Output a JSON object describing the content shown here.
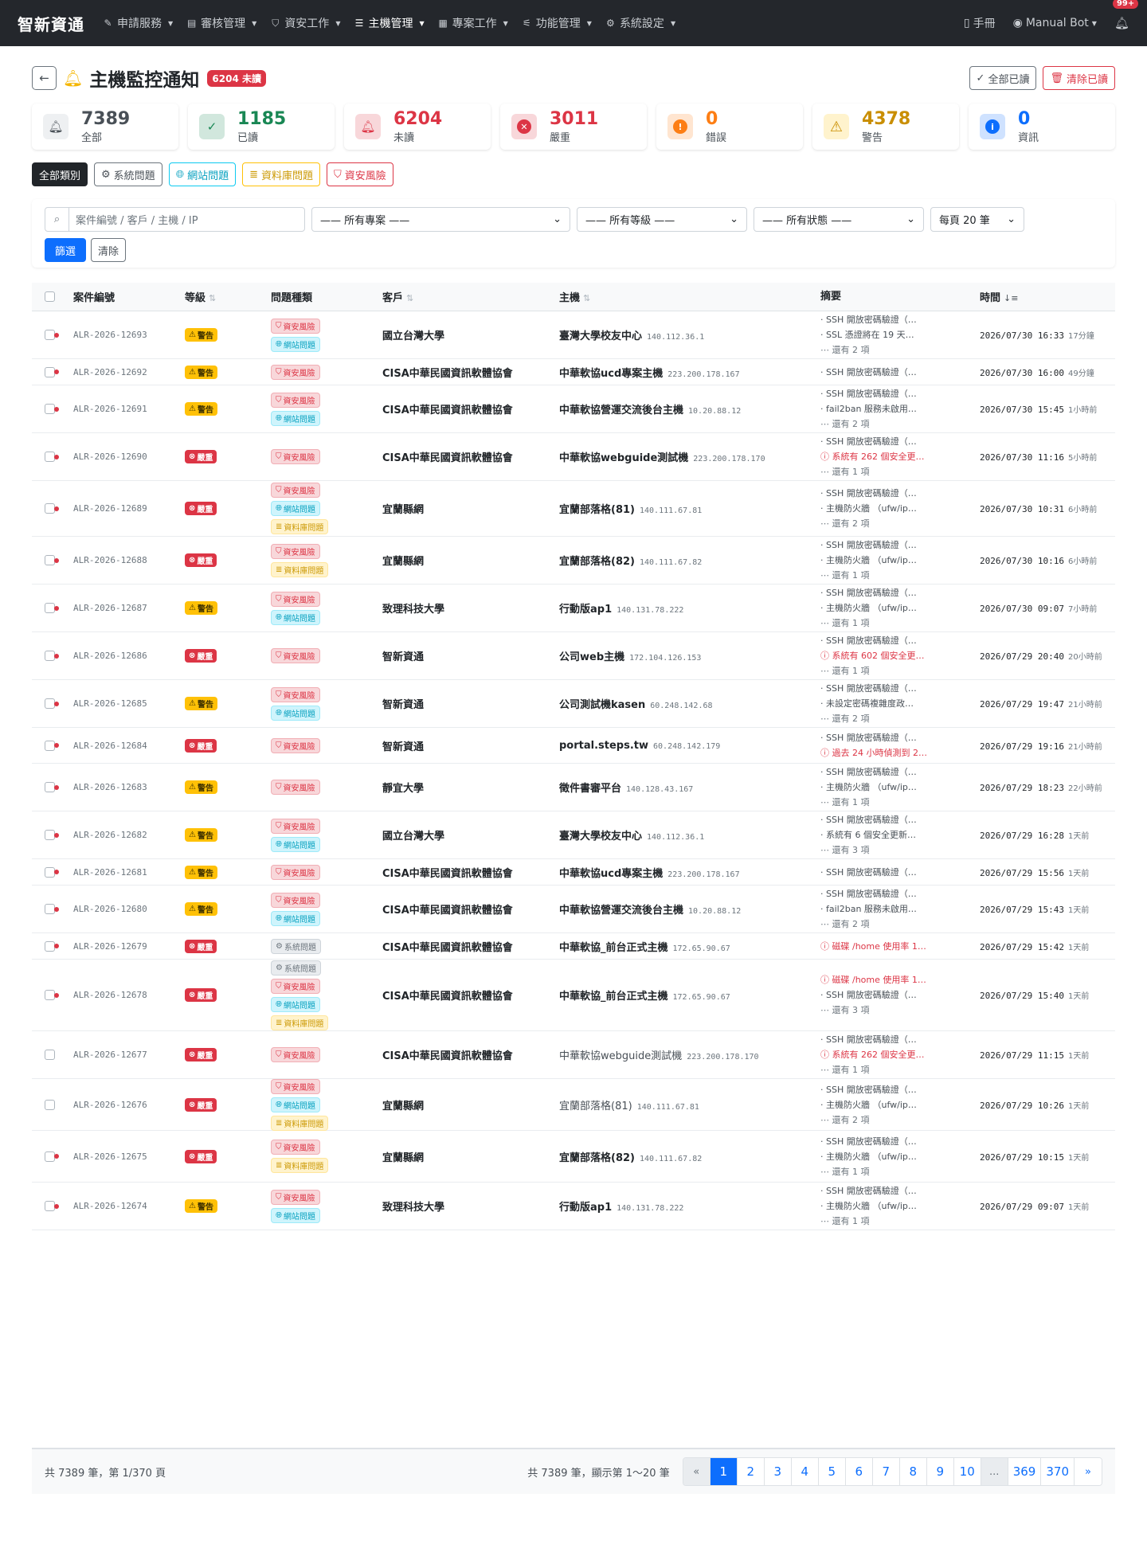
{
  "nav": {
    "brand": "智新資通",
    "items": [
      {
        "label": "申請服務",
        "icon": "edit-icon",
        "glyph": "✎"
      },
      {
        "label": "審核管理",
        "icon": "clipboard-icon",
        "glyph": "▤"
      },
      {
        "label": "資安工作",
        "icon": "shield-icon",
        "glyph": "⛉"
      },
      {
        "label": "主機管理",
        "icon": "server-icon",
        "glyph": "☰"
      },
      {
        "label": "專案工作",
        "icon": "kanban-icon",
        "glyph": "▦"
      },
      {
        "label": "功能管理",
        "icon": "sliders-icon",
        "glyph": "⚟"
      },
      {
        "label": "系統設定",
        "icon": "gear-icon",
        "glyph": "⚙"
      }
    ],
    "manual": "手冊",
    "user": "Manual Bot",
    "bell_badge": "99+"
  },
  "header": {
    "title": "主機監控通知",
    "badge": "6204 未讀",
    "mark_all_read": "全部已讀",
    "clear_read": "清除已讀"
  },
  "stats": [
    {
      "num": "7389",
      "label": "全部",
      "color": "#495057",
      "bg": "#eef0f2",
      "glyph": "🔔︎",
      "icon": "bell-icon"
    },
    {
      "num": "1185",
      "label": "已讀",
      "color": "#198754",
      "bg": "#d1e7dd",
      "glyph": "✓",
      "icon": "check-circle-icon"
    },
    {
      "num": "6204",
      "label": "未讀",
      "color": "#dc3545",
      "bg": "#f8d7da",
      "glyph": "🔔︎",
      "icon": "bell-fill-icon"
    },
    {
      "num": "3011",
      "label": "嚴重",
      "color": "#dc3545",
      "bg": "#f8d7da",
      "glyph": "✕",
      "icon": "x-circle-icon"
    },
    {
      "num": "0",
      "label": "錯誤",
      "color": "#fd7e14",
      "bg": "#ffe5d0",
      "glyph": "!",
      "icon": "exclamation-octagon-icon"
    },
    {
      "num": "4378",
      "label": "警告",
      "color": "#c98e00",
      "bg": "#fff3cd",
      "glyph": "⚠",
      "icon": "warning-triangle-icon"
    },
    {
      "num": "0",
      "label": "資訊",
      "color": "#0d6efd",
      "bg": "#cfe2ff",
      "glyph": "i",
      "icon": "info-circle-icon"
    }
  ],
  "categories": [
    {
      "label": "全部類別",
      "glyph": "",
      "border": "#212529",
      "color": "#fff",
      "bg": "#212529"
    },
    {
      "label": "系統問題",
      "glyph": "⚙",
      "border": "#6c757d",
      "color": "#495057",
      "bg": "#fff"
    },
    {
      "label": "網站問題",
      "glyph": "🌐︎",
      "border": "#0dcaf0",
      "color": "#0aa2c0",
      "bg": "#fff"
    },
    {
      "label": "資料庫問題",
      "glyph": "≣",
      "border": "#ffc107",
      "color": "#cc9a06",
      "bg": "#fff"
    },
    {
      "label": "資安風險",
      "glyph": "⛉",
      "border": "#dc3545",
      "color": "#dc3545",
      "bg": "#fff"
    }
  ],
  "filter": {
    "search_placeholder": "案件編號 / 客戶 / 主機 / IP",
    "project": "—— 所有專案 ——",
    "level": "—— 所有等級 ——",
    "status": "—— 所有狀態 ——",
    "per_page": "每頁 20 筆",
    "submit": "篩選",
    "clear": "清除"
  },
  "columns": {
    "id": "案件編號",
    "level": "等級",
    "type": "問題種類",
    "customer": "客戶",
    "host": "主機",
    "summary": "摘要",
    "time": "時間"
  },
  "level_labels": {
    "warn": "警告",
    "crit": "嚴重"
  },
  "type_labels": {
    "sec": "資安風險",
    "web": "網站問題",
    "db": "資料庫問題",
    "sys": "系統問題"
  },
  "rows": [
    {
      "id": "ALR-2026-12693",
      "level": "warn",
      "types": [
        "sec",
        "web"
      ],
      "customer": "國立台灣大學",
      "host": "臺灣大學校友中心",
      "ip": "140.112.36.1",
      "unread": true,
      "summary": [
        {
          "t": "· SSH 開放密碼驗證（…"
        },
        {
          "t": "· SSL 憑證將在 19 天…"
        }
      ],
      "more": "⋯ 還有 2 項",
      "time": "2026/07/30 16:33",
      "ago": "17分鐘"
    },
    {
      "id": "ALR-2026-12692",
      "level": "warn",
      "types": [
        "sec"
      ],
      "customer": "CISA中華民國資訊軟體協會",
      "host": "中華軟協ucd專案主機",
      "ip": "223.200.178.167",
      "unread": true,
      "summary": [
        {
          "t": "· SSH 開放密碼驗證（…"
        }
      ],
      "more": "",
      "time": "2026/07/30 16:00",
      "ago": "49分鐘"
    },
    {
      "id": "ALR-2026-12691",
      "level": "warn",
      "types": [
        "sec",
        "web"
      ],
      "customer": "CISA中華民國資訊軟體協會",
      "host": "中華軟協營運交流後台主機",
      "ip": "10.20.88.12",
      "unread": true,
      "summary": [
        {
          "t": "· SSH 開放密碼驗證（…"
        },
        {
          "t": "· fail2ban 服務未啟用…"
        }
      ],
      "more": "⋯ 還有 2 項",
      "time": "2026/07/30 15:45",
      "ago": "1小時前"
    },
    {
      "id": "ALR-2026-12690",
      "level": "crit",
      "types": [
        "sec"
      ],
      "customer": "CISA中華民國資訊軟體協會",
      "host": "中華軟協webguide測試機",
      "ip": "223.200.178.170",
      "unread": true,
      "summary": [
        {
          "t": "· SSH 開放密碼驗證（…"
        },
        {
          "t": "ⓘ 系統有 262 個安全更…",
          "err": true
        }
      ],
      "more": "⋯ 還有 1 項",
      "time": "2026/07/30 11:16",
      "ago": "5小時前"
    },
    {
      "id": "ALR-2026-12689",
      "level": "crit",
      "types": [
        "sec",
        "web",
        "db"
      ],
      "customer": "宜蘭縣網",
      "host": "宜蘭部落格(81)",
      "ip": "140.111.67.81",
      "unread": true,
      "summary": [
        {
          "t": "· SSH 開放密碼驗證（…"
        },
        {
          "t": "· 主機防火牆 （ufw/ip…"
        }
      ],
      "more": "⋯ 還有 2 項",
      "time": "2026/07/30 10:31",
      "ago": "6小時前"
    },
    {
      "id": "ALR-2026-12688",
      "level": "crit",
      "types": [
        "sec",
        "db"
      ],
      "customer": "宜蘭縣網",
      "host": "宜蘭部落格(82)",
      "ip": "140.111.67.82",
      "unread": true,
      "summary": [
        {
          "t": "· SSH 開放密碼驗證（…"
        },
        {
          "t": "· 主機防火牆 （ufw/ip…"
        }
      ],
      "more": "⋯ 還有 1 項",
      "time": "2026/07/30 10:16",
      "ago": "6小時前"
    },
    {
      "id": "ALR-2026-12687",
      "level": "warn",
      "types": [
        "sec",
        "web"
      ],
      "customer": "致理科技大學",
      "host": "行動版ap1",
      "ip": "140.131.78.222",
      "unread": true,
      "summary": [
        {
          "t": "· SSH 開放密碼驗證（…"
        },
        {
          "t": "· 主機防火牆 （ufw/ip…"
        }
      ],
      "more": "⋯ 還有 1 項",
      "time": "2026/07/30 09:07",
      "ago": "7小時前"
    },
    {
      "id": "ALR-2026-12686",
      "level": "crit",
      "types": [
        "sec"
      ],
      "customer": "智新資通",
      "host": "公司web主機",
      "ip": "172.104.126.153",
      "unread": true,
      "summary": [
        {
          "t": "· SSH 開放密碼驗證（…"
        },
        {
          "t": "ⓘ 系統有 602 個安全更…",
          "err": true
        }
      ],
      "more": "⋯ 還有 1 項",
      "time": "2026/07/29 20:40",
      "ago": "20小時前"
    },
    {
      "id": "ALR-2026-12685",
      "level": "warn",
      "types": [
        "sec",
        "web"
      ],
      "customer": "智新資通",
      "host": "公司測試機kasen",
      "ip": "60.248.142.68",
      "unread": true,
      "summary": [
        {
          "t": "· SSH 開放密碼驗證（…"
        },
        {
          "t": "· 未設定密碼複雜度政…"
        }
      ],
      "more": "⋯ 還有 2 項",
      "time": "2026/07/29 19:47",
      "ago": "21小時前"
    },
    {
      "id": "ALR-2026-12684",
      "level": "crit",
      "types": [
        "sec"
      ],
      "customer": "智新資通",
      "host": "portal.steps.tw",
      "ip": "60.248.142.179",
      "unread": true,
      "summary": [
        {
          "t": "· SSH 開放密碼驗證（…"
        },
        {
          "t": "ⓘ 過去 24 小時偵測到 2…",
          "err": true
        }
      ],
      "more": "",
      "time": "2026/07/29 19:16",
      "ago": "21小時前"
    },
    {
      "id": "ALR-2026-12683",
      "level": "warn",
      "types": [
        "sec"
      ],
      "customer": "靜宜大學",
      "host": "徵件書審平台",
      "ip": "140.128.43.167",
      "unread": true,
      "summary": [
        {
          "t": "· SSH 開放密碼驗證（…"
        },
        {
          "t": "· 主機防火牆 （ufw/ip…"
        }
      ],
      "more": "⋯ 還有 1 項",
      "time": "2026/07/29 18:23",
      "ago": "22小時前"
    },
    {
      "id": "ALR-2026-12682",
      "level": "warn",
      "types": [
        "sec",
        "web"
      ],
      "customer": "國立台灣大學",
      "host": "臺灣大學校友中心",
      "ip": "140.112.36.1",
      "unread": true,
      "summary": [
        {
          "t": "· SSH 開放密碼驗證（…"
        },
        {
          "t": "· 系統有 6 個安全更新…"
        }
      ],
      "more": "⋯ 還有 3 項",
      "time": "2026/07/29 16:28",
      "ago": "1天前"
    },
    {
      "id": "ALR-2026-12681",
      "level": "warn",
      "types": [
        "sec"
      ],
      "customer": "CISA中華民國資訊軟體協會",
      "host": "中華軟協ucd專案主機",
      "ip": "223.200.178.167",
      "unread": true,
      "summary": [
        {
          "t": "· SSH 開放密碼驗證（…"
        }
      ],
      "more": "",
      "time": "2026/07/29 15:56",
      "ago": "1天前"
    },
    {
      "id": "ALR-2026-12680",
      "level": "warn",
      "types": [
        "sec",
        "web"
      ],
      "customer": "CISA中華民國資訊軟體協會",
      "host": "中華軟協營運交流後台主機",
      "ip": "10.20.88.12",
      "unread": true,
      "summary": [
        {
          "t": "· SSH 開放密碼驗證（…"
        },
        {
          "t": "· fail2ban 服務未啟用…"
        }
      ],
      "more": "⋯ 還有 2 項",
      "time": "2026/07/29 15:43",
      "ago": "1天前"
    },
    {
      "id": "ALR-2026-12679",
      "level": "crit",
      "types": [
        "sys"
      ],
      "customer": "CISA中華民國資訊軟體協會",
      "host": "中華軟協_前台正式主機",
      "ip": "172.65.90.67",
      "unread": true,
      "summary": [
        {
          "t": "ⓘ 磁碟 /home 使用率 1…",
          "err": true
        }
      ],
      "more": "",
      "time": "2026/07/29 15:42",
      "ago": "1天前"
    },
    {
      "id": "ALR-2026-12678",
      "level": "crit",
      "types": [
        "sys",
        "sec",
        "web",
        "db"
      ],
      "customer": "CISA中華民國資訊軟體協會",
      "host": "中華軟協_前台正式主機",
      "ip": "172.65.90.67",
      "unread": true,
      "summary": [
        {
          "t": "ⓘ 磁碟 /home 使用率 1…",
          "err": true
        },
        {
          "t": "· SSH 開放密碼驗證（…"
        }
      ],
      "more": "⋯ 還有 3 項",
      "time": "2026/07/29 15:40",
      "ago": "1天前"
    },
    {
      "id": "ALR-2026-12677",
      "level": "crit",
      "types": [
        "sec"
      ],
      "customer": "CISA中華民國資訊軟體協會",
      "host": "中華軟協webguide測試機",
      "ip": "223.200.178.170",
      "unread": false,
      "summary": [
        {
          "t": "· SSH 開放密碼驗證（…"
        },
        {
          "t": "ⓘ 系統有 262 個安全更…",
          "err": true
        }
      ],
      "more": "⋯ 還有 1 項",
      "time": "2026/07/29 11:15",
      "ago": "1天前"
    },
    {
      "id": "ALR-2026-12676",
      "level": "crit",
      "types": [
        "sec",
        "web",
        "db"
      ],
      "customer": "宜蘭縣網",
      "host": "宜蘭部落格(81)",
      "ip": "140.111.67.81",
      "unread": false,
      "summary": [
        {
          "t": "· SSH 開放密碼驗證（…"
        },
        {
          "t": "· 主機防火牆 （ufw/ip…"
        }
      ],
      "more": "⋯ 還有 2 項",
      "time": "2026/07/29 10:26",
      "ago": "1天前"
    },
    {
      "id": "ALR-2026-12675",
      "level": "crit",
      "types": [
        "sec",
        "db"
      ],
      "customer": "宜蘭縣網",
      "host": "宜蘭部落格(82)",
      "ip": "140.111.67.82",
      "unread": true,
      "summary": [
        {
          "t": "· SSH 開放密碼驗證（…"
        },
        {
          "t": "· 主機防火牆 （ufw/ip…"
        }
      ],
      "more": "⋯ 還有 1 項",
      "time": "2026/07/29 10:15",
      "ago": "1天前"
    },
    {
      "id": "ALR-2026-12674",
      "level": "warn",
      "types": [
        "sec",
        "web"
      ],
      "customer": "致理科技大學",
      "host": "行動版ap1",
      "ip": "140.131.78.222",
      "unread": true,
      "summary": [
        {
          "t": "· SSH 開放密碼驗證（…"
        },
        {
          "t": "· 主機防火牆 （ufw/ip…"
        }
      ],
      "more": "⋯ 還有 1 項",
      "time": "2026/07/29 09:07",
      "ago": "1天前"
    }
  ],
  "footer": {
    "left": "共 7389 筆，第 1/370 頁",
    "mid": "共 7389 筆，顯示第 1～20 筆",
    "pages": [
      "«",
      "1",
      "2",
      "3",
      "4",
      "5",
      "6",
      "7",
      "8",
      "9",
      "10",
      "...",
      "369",
      "370",
      "»"
    ]
  }
}
